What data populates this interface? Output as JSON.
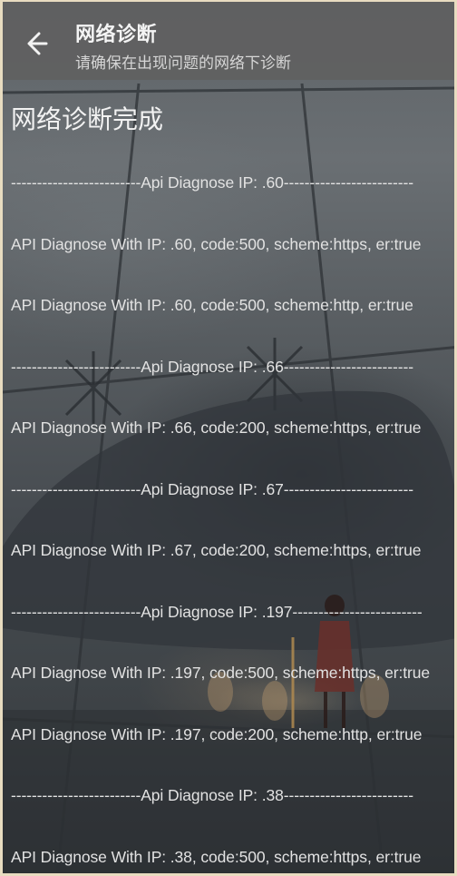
{
  "header": {
    "title": "网络诊断",
    "subtitle": "请确保在出现问题的网络下诊断",
    "back_icon": "back-arrow-icon"
  },
  "main": {
    "status_title": "网络诊断完成",
    "log_lines": [
      "-------------------------Api Diagnose IP: .60-------------------------",
      "API Diagnose With IP:  .60, code:500, scheme:https, er:true",
      "API Diagnose With IP:  .60, code:500, scheme:http, er:true",
      "-------------------------Api Diagnose IP: .66-------------------------",
      "API Diagnose With IP:  .66, code:200, scheme:https, er:true",
      "-------------------------Api Diagnose IP: .67-------------------------",
      "API Diagnose With IP:  .67, code:200, scheme:https, er:true",
      "-------------------------Api Diagnose IP: .197-------------------------",
      "API Diagnose With IP:  .197, code:500, scheme:https, er:true",
      "API Diagnose With IP:  .197, code:200, scheme:http, er:true",
      "-------------------------Api Diagnose IP: .38-------------------------",
      "API Diagnose With IP:  .38, code:500, scheme:https, er:true"
    ]
  },
  "colors": {
    "appbar_bg": "#606060",
    "text_primary": "#f2f2f2",
    "text_secondary": "#d6d6d6",
    "frame": "#e8dcc0"
  }
}
